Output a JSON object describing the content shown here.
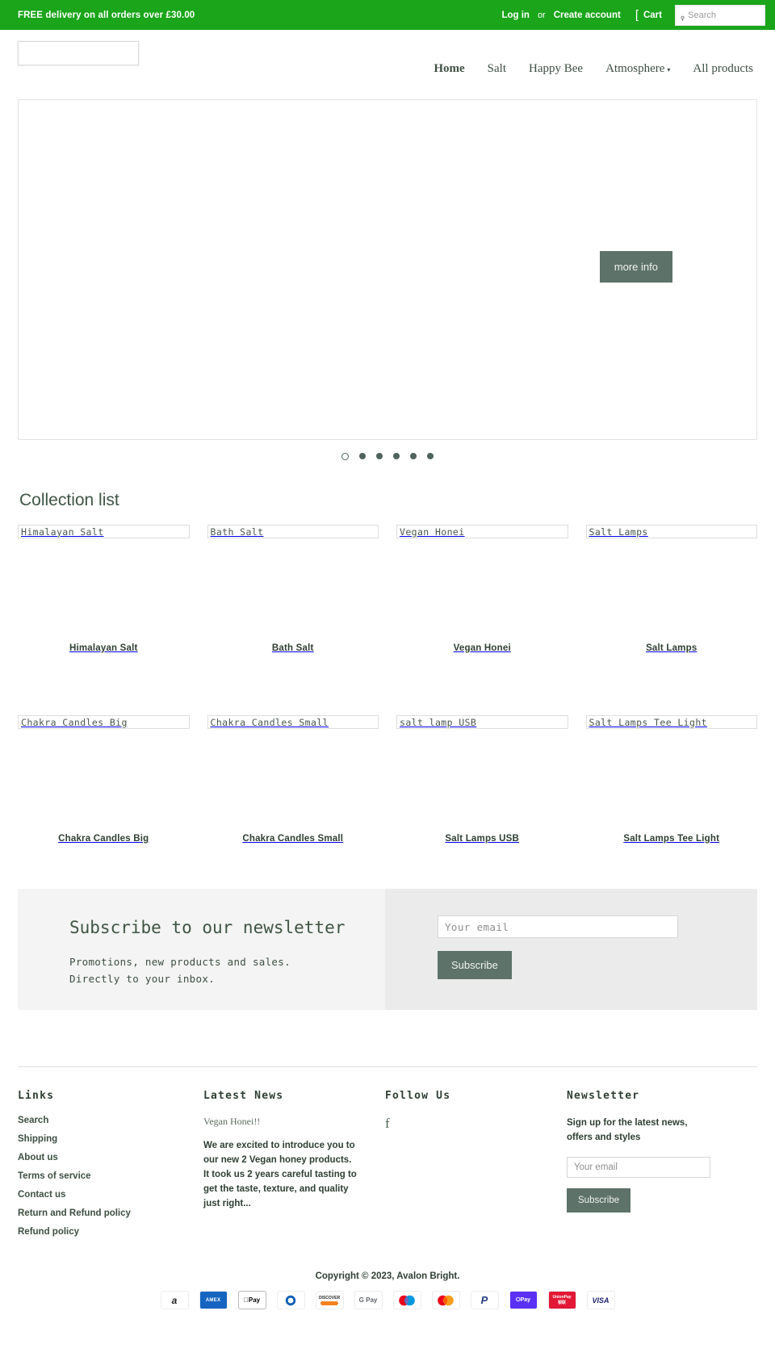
{
  "announcement": {
    "text": "FREE delivery on all orders over £30.00",
    "login_label": "Log in",
    "or_label": "or",
    "create_account_label": "Create account",
    "cart_label": "Cart",
    "cart_icon": "cart-icon",
    "search_icon": "search-icon",
    "search_placeholder": "Search",
    "bg_color": "#1aa51a"
  },
  "header": {
    "logo_alt": "",
    "nav": [
      {
        "label": "Home",
        "active": true,
        "has_dropdown": false
      },
      {
        "label": "Salt",
        "active": false,
        "has_dropdown": false
      },
      {
        "label": "Happy Bee",
        "active": false,
        "has_dropdown": false
      },
      {
        "label": "Atmosphere",
        "active": false,
        "has_dropdown": true
      },
      {
        "label": "All products",
        "active": false,
        "has_dropdown": false
      }
    ],
    "caret_glyph": "▾"
  },
  "hero": {
    "button_label": "more info",
    "button_color": "#5d7269",
    "slide_count": 6,
    "active_slide": 1
  },
  "collections": {
    "title": "Collection list",
    "items": [
      {
        "alt": "Himalayan Salt",
        "caption": "Himalayan Salt"
      },
      {
        "alt": "Bath Salt",
        "caption": "Bath Salt"
      },
      {
        "alt": "Vegan Honei",
        "caption": "Vegan Honei"
      },
      {
        "alt": "Salt Lamps",
        "caption": "Salt Lamps"
      },
      {
        "alt": "Chakra Candles Big",
        "caption": "Chakra Candles Big"
      },
      {
        "alt": "Chakra Candles Small",
        "caption": "Chakra Candles Small"
      },
      {
        "alt": "salt lamp USB",
        "caption": "Salt Lamps USB"
      },
      {
        "alt": "Salt Lamps Tee Light",
        "caption": "Salt Lamps Tee Light"
      }
    ]
  },
  "promo": {
    "title": "Subscribe to our newsletter",
    "line1": "Promotions, new products and sales.",
    "line2": "Directly to your inbox.",
    "email_placeholder": "Your email",
    "subscribe_label": "Subscribe"
  },
  "footer": {
    "links": {
      "title": "Links",
      "items": [
        "Search",
        "Shipping",
        "About us",
        "Terms of service",
        "Contact us",
        "Return and Refund policy",
        "Refund policy"
      ]
    },
    "latest_news": {
      "title": "Latest News",
      "post_title": "Vegan Honei!!",
      "post_body": "  We are excited to introduce you to our new 2 Vegan honey products. It took us 2 years careful tasting to get the taste, texture, and quality just right..."
    },
    "follow_us": {
      "title": "Follow Us",
      "facebook_icon": "facebook-icon",
      "facebook_glyph": "f"
    },
    "newsletter": {
      "title": "Newsletter",
      "description": "Sign up for the latest news, offers and styles",
      "email_placeholder": "Your email",
      "subscribe_label": "Subscribe"
    },
    "copyright": "Copyright © 2023, Avalon Bright.",
    "payment_methods": [
      {
        "name": "amazon",
        "label": "a",
        "bg": "#ffffff",
        "fg": "#222222"
      },
      {
        "name": "amex",
        "label": "AMEX",
        "bg": "#1565c0",
        "fg": "#ffffff"
      },
      {
        "name": "apple-pay",
        "label": "Pay",
        "bg": "#ffffff",
        "fg": "#000000"
      },
      {
        "name": "diners-club",
        "label": "",
        "bg": "#ffffff",
        "fg": "#0a5eb5"
      },
      {
        "name": "discover",
        "label": "DISCOVER",
        "bg": "#ffffff",
        "fg": "#2b2b2b"
      },
      {
        "name": "google-pay",
        "label": "G Pay",
        "bg": "#ffffff",
        "fg": "#5f6368"
      },
      {
        "name": "maestro",
        "label": "",
        "bg": "#ffffff",
        "fg": "#0a5eb5"
      },
      {
        "name": "mastercard",
        "label": "",
        "bg": "#ffffff",
        "fg": "#eb001b"
      },
      {
        "name": "paypal",
        "label": "P",
        "bg": "#ffffff",
        "fg": "#253b80"
      },
      {
        "name": "shop-pay",
        "label": "Pay",
        "bg": "#5a31f4",
        "fg": "#ffffff"
      },
      {
        "name": "union-pay",
        "label": "UnionPay",
        "bg": "#e21836",
        "fg": "#ffffff"
      },
      {
        "name": "visa",
        "label": "VISA",
        "bg": "#ffffff",
        "fg": "#1a1f71"
      }
    ]
  }
}
